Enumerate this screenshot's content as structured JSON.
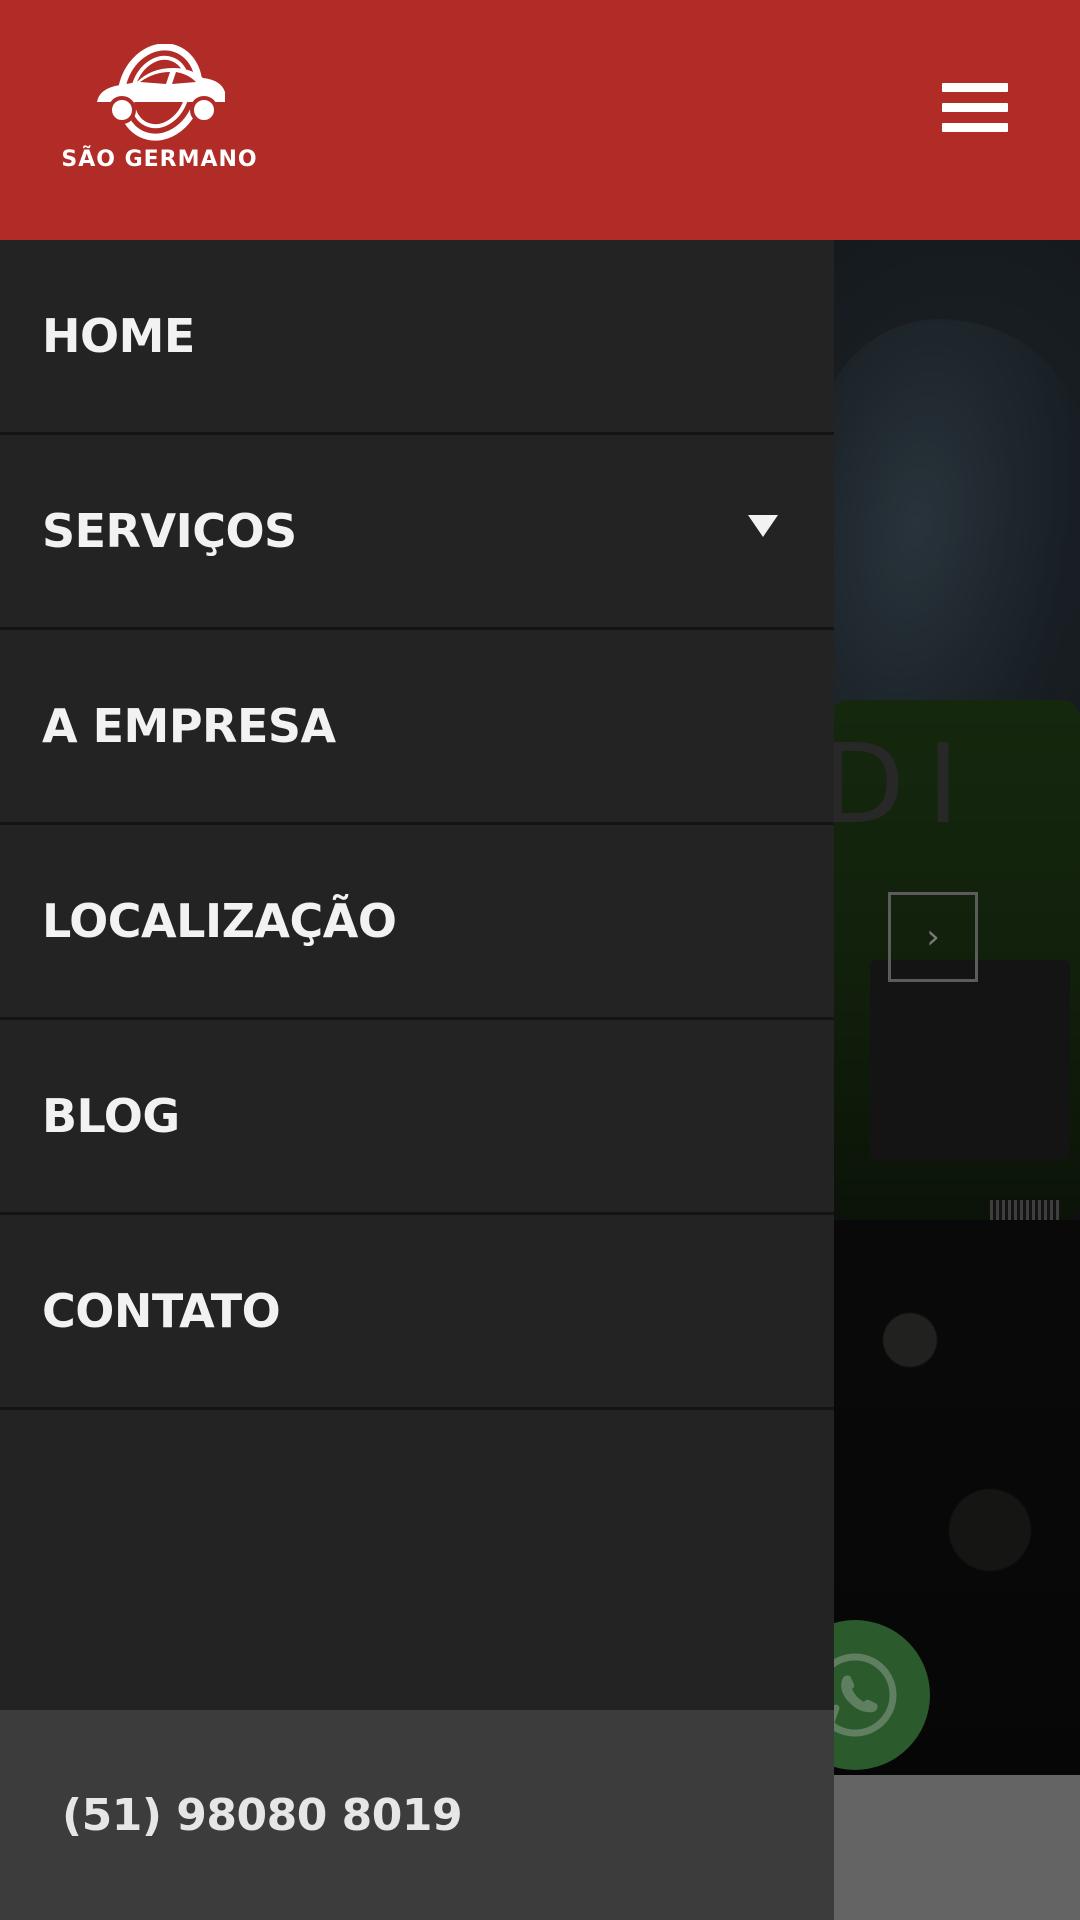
{
  "header": {
    "brand_name": "SÃO GERMANO",
    "background_color": "#b22c27"
  },
  "menu": {
    "items": [
      {
        "label": "HOME",
        "has_dropdown": false
      },
      {
        "label": "SERVIÇOS",
        "has_dropdown": true
      },
      {
        "label": "A EMPRESA",
        "has_dropdown": false
      },
      {
        "label": "LOCALIZAÇÃO",
        "has_dropdown": false
      },
      {
        "label": "BLOG",
        "has_dropdown": false
      },
      {
        "label": "CONTATO",
        "has_dropdown": false
      }
    ],
    "phone": "(51) 98080 8019"
  },
  "hero": {
    "partial_heading": "DI"
  },
  "icons": {
    "logo": "car-wheel-logo-icon",
    "menu": "hamburger-menu-icon",
    "dropdown": "triangle-down-icon",
    "slider_next": "chevron-right-icon",
    "whatsapp": "whatsapp-icon"
  },
  "colors": {
    "drawer_bg": "#232323",
    "drawer_footer_bg": "#3c3c3c",
    "whatsapp_green": "#2b5a2d"
  }
}
